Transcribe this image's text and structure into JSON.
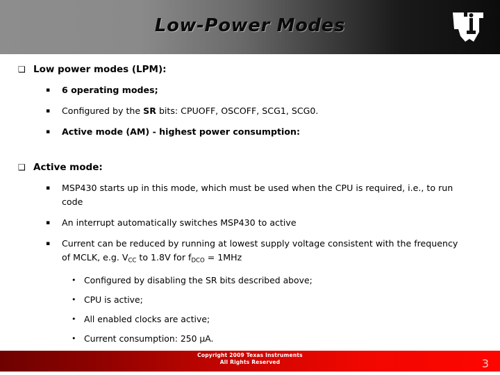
{
  "header": {
    "title": "Low-Power Modes",
    "logo_name": "ti-logo",
    "logo_text": "ti"
  },
  "markers": {
    "level1": "❑",
    "level2": "▪",
    "level3": "•"
  },
  "content": {
    "sections": [
      {
        "heading": "Low power modes (LPM):",
        "items": [
          {
            "text": "6 operating modes;",
            "bold": true
          },
          {
            "text_pre": "Configured by the ",
            "text_bold": "SR",
            "text_post": " bits:  CPUOFF, OSCOFF, SCG1, SCG0.",
            "bold": false
          },
          {
            "text": "Active mode (AM) - highest power consumption:",
            "bold": true
          }
        ]
      },
      {
        "heading": "Active mode:",
        "items": [
          {
            "text": "MSP430 starts up in this mode, which must be used when the CPU is required, i.e., to run code",
            "bold": false
          },
          {
            "text": "An interrupt automatically switches MSP430 to active",
            "bold": false
          },
          {
            "text_pre": "Current can be reduced by running at lowest supply voltage consistent with the frequency of MCLK, e.g. V",
            "sub1": "CC",
            "text_mid": " to 1.8V for f",
            "sub2": "DCO",
            "text_post": " = 1MHz",
            "bold": false
          }
        ],
        "subitems": [
          "Configured by disabling the SR bits described above;",
          "CPU is active;",
          "All enabled clocks are active;",
          "Current consumption: 250 µA."
        ]
      }
    ]
  },
  "footer": {
    "copyright_line1": "Copyright  2009 Texas Instruments",
    "copyright_line2": "All Rights Reserved",
    "page_number": "3"
  }
}
